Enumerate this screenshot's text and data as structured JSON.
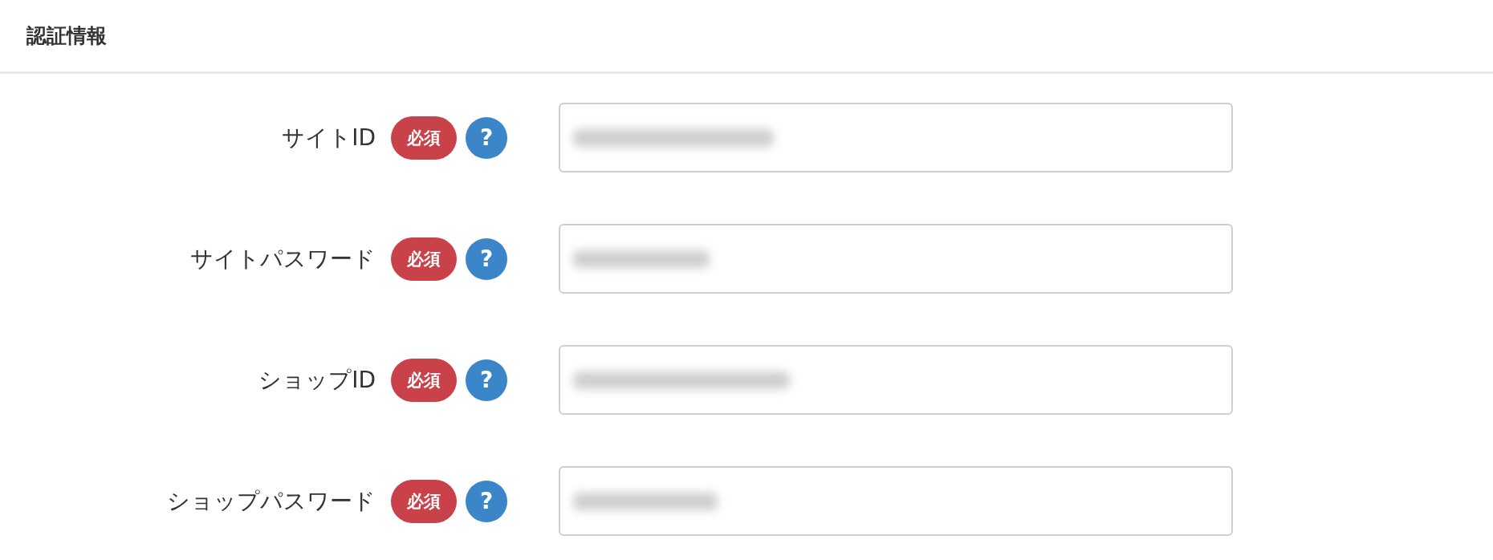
{
  "section": {
    "title": "認証情報"
  },
  "fields": [
    {
      "label": "サイトID",
      "required_badge": "必須",
      "help": "?"
    },
    {
      "label": "サイトパスワード",
      "required_badge": "必須",
      "help": "?"
    },
    {
      "label": "ショップID",
      "required_badge": "必須",
      "help": "?"
    },
    {
      "label": "ショップパスワード",
      "required_badge": "必須",
      "help": "?"
    }
  ]
}
